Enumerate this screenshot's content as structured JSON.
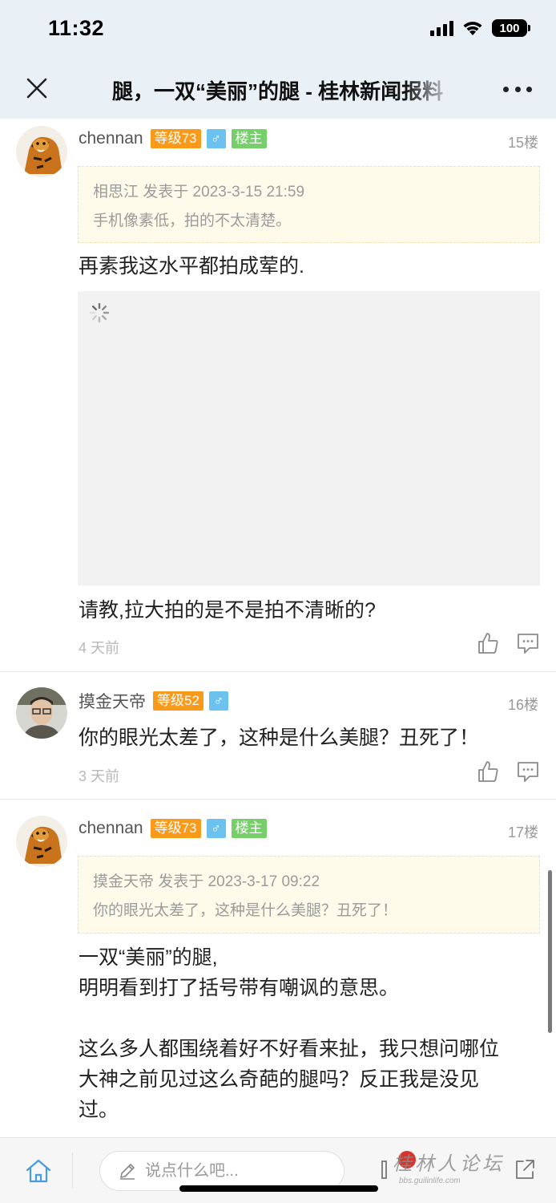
{
  "status_bar": {
    "time": "11:32",
    "battery": "100"
  },
  "header": {
    "title": "腿，一双“美丽”的腿 - 桂林新闻报料"
  },
  "posts": [
    {
      "author": "chennan",
      "level": "等级73",
      "gender_symbol": "♂",
      "owner_tag": "楼主",
      "floor": "15楼",
      "quote_header": "相思江 发表于 2023-3-15 21:59",
      "quote_text": "手机像素低，拍的不太清楚。",
      "content_lines": [
        "再素我这水平都拍成荤的."
      ],
      "content_after_image": "请教,拉大拍的是不是拍不清晰的?",
      "time": "4 天前"
    },
    {
      "author": "摸金天帝",
      "level": "等级52",
      "gender_symbol": "♂",
      "floor": "16楼",
      "content_lines": [
        "你的眼光太差了，这种是什么美腿？丑死了！"
      ],
      "time": "3 天前"
    },
    {
      "author": "chennan",
      "level": "等级73",
      "gender_symbol": "♂",
      "owner_tag": "楼主",
      "floor": "17楼",
      "quote_header": "摸金天帝 发表于 2023-3-17 09:22",
      "quote_text": "你的眼光太差了，这种是什么美腿？丑死了！",
      "content_lines": [
        "一双“美丽”的腿,",
        "明明看到打了括号带有嘲讽的意思。",
        "",
        "这么多人都围绕着好不好看来扯，我只想问哪位",
        "大神之前见过这么奇葩的腿吗？反正我是没见",
        "过。"
      ]
    }
  ],
  "bottom_bar": {
    "comment_placeholder": "说点什么吧...",
    "watermark": "桂林人论坛",
    "watermark_sub": "bbs.guilinlife.com"
  },
  "colors": {
    "header_bg": "#e9f1f7",
    "level_badge": "#f99a1b",
    "gender_badge": "#6cc2ef",
    "owner_badge": "#76cf6a",
    "quote_bg": "#fffbea"
  },
  "icons": [
    "close-icon",
    "more-icon",
    "avatar-tiger",
    "avatar-man",
    "spinner-icon",
    "like-icon",
    "comment-icon",
    "home-icon",
    "pencil-icon",
    "share-icon"
  ]
}
